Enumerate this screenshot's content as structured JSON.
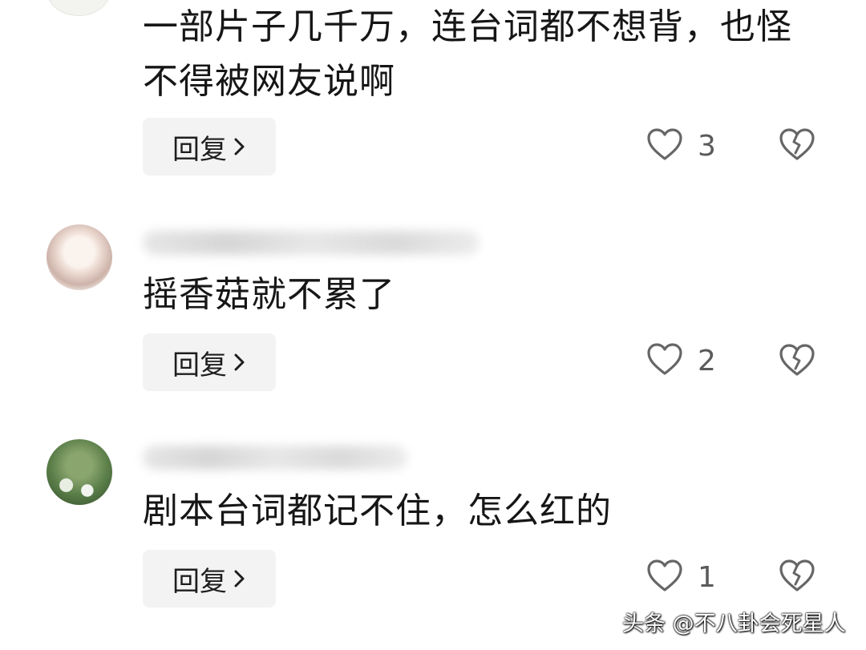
{
  "comments": [
    {
      "text": "一部片子几千万，连台词都不想背，也怪不得被网友说啊",
      "reply_label": "回复",
      "likes": "3"
    },
    {
      "text": "摇香菇就不累了",
      "reply_label": "回复",
      "likes": "2"
    },
    {
      "text": "剧本台词都记不住，怎么红的",
      "reply_label": "回复",
      "likes": "1"
    }
  ],
  "icons": {
    "like": "heart-outline-icon",
    "dislike": "broken-heart-icon",
    "reply_arrow": "chevron-right-icon"
  },
  "watermark": "头条 @不八卦会死星人",
  "colors": {
    "text": "#161616",
    "reply_bg": "#f3f3f3",
    "count": "#5a5a5a",
    "icon_stroke": "#666666"
  }
}
